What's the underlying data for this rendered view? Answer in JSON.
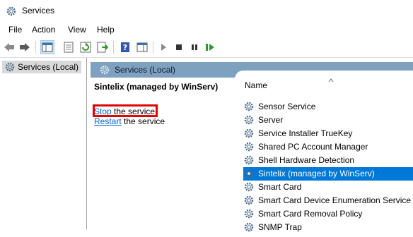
{
  "window": {
    "title": "Services"
  },
  "menu": [
    "File",
    "Action",
    "View",
    "Help"
  ],
  "toolbar": {
    "icons": [
      "back-icon",
      "forward-icon",
      "show-hide-console-tree-icon",
      "properties-icon",
      "refresh-icon",
      "export-list-icon",
      "help-icon",
      "show-hide-action-pane-icon",
      "start-service-icon",
      "stop-service-icon",
      "pause-service-icon",
      "restart-service-icon"
    ]
  },
  "tree": {
    "root": "Services (Local)"
  },
  "pane": {
    "header": "Services (Local)",
    "selected_service": "Sintelix (managed by WinServ)",
    "actions": [
      {
        "link": "Stop",
        "rest": " the service"
      },
      {
        "link": "Restart",
        "rest": " the service"
      }
    ]
  },
  "list": {
    "column": "Name",
    "rows": [
      "Sensor Service",
      "Server",
      "Service Installer TrueKey",
      "Shared PC Account Manager",
      "Shell Hardware Detection",
      "Sintelix (managed by WinServ)",
      "Smart Card",
      "Smart Card Device Enumeration Service",
      "Smart Card Removal Policy",
      "SNMP Trap"
    ],
    "selected_index": 5
  },
  "colors": {
    "header_bar": "#7fa1c0",
    "selection": "#0078d7",
    "link": "#0066cc",
    "highlight": "#e20000"
  }
}
